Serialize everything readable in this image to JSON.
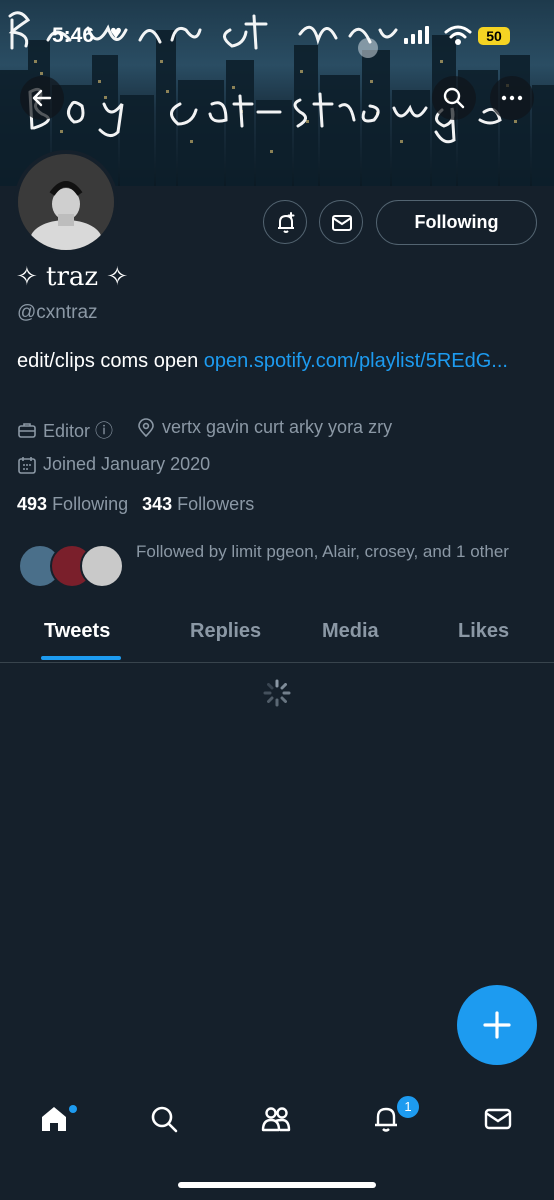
{
  "status_bar": {
    "time": "5:46",
    "battery": "50"
  },
  "banner": {
    "scribble_text": "Batman cat Man Boy cat Strong"
  },
  "profile": {
    "display_name": "✧ traz ✧",
    "handle": "@cxntraz",
    "bio_text": "edit/clips coms open ",
    "bio_link": "open.spotify.com/playlist/5REdG...",
    "job": "Editor ⓘ",
    "location": "vertx gavin curt arky yora zry",
    "joined": "Joined January 2020",
    "following_count": "493",
    "following_label": "Following",
    "followers_count": "343",
    "followers_label": "Followers",
    "followed_by": "Followed by limit pgeon, Alair, crosey, and 1 other"
  },
  "actions": {
    "follow_button": "Following"
  },
  "tabs": [
    {
      "label": "Tweets",
      "active": true
    },
    {
      "label": "Replies"
    },
    {
      "label": "Media"
    },
    {
      "label": "Likes"
    }
  ],
  "nav": {
    "items": [
      "home-icon",
      "search-icon",
      "communities-icon",
      "notifications-icon",
      "messages-icon"
    ],
    "notification_badge": "1"
  },
  "colors": {
    "accent": "#1d9bf0",
    "background": "#15202b",
    "muted": "#8b98a5"
  }
}
